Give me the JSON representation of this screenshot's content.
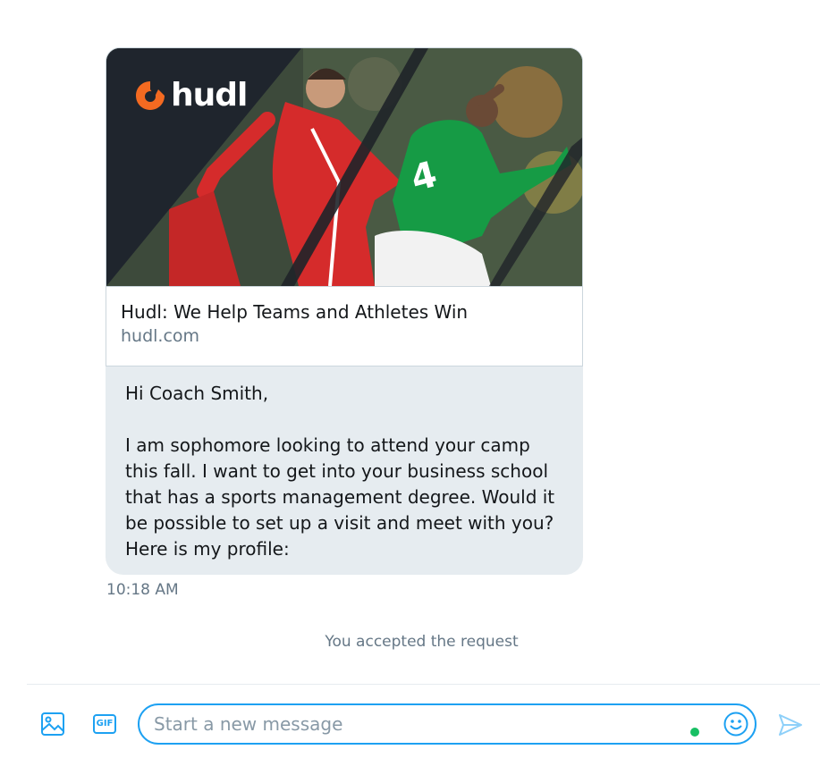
{
  "link_card": {
    "brand": "hudl",
    "title": "Hudl: We Help Teams and Athletes Win",
    "domain": "hudl.com"
  },
  "message": {
    "greeting": "Hi Coach Smith,",
    "body": "I am sophomore looking to attend your camp this fall. I want to get into your business school that has a sports management degree.   Would it be possible to set up a visit and meet with you? Here is my profile:",
    "timestamp": "10:18 AM"
  },
  "system_note": "You accepted the request",
  "composer": {
    "placeholder": "Start a new message",
    "value": "",
    "gif_label": "GIF"
  },
  "colors": {
    "accent": "#1da1f2",
    "bubble_bg": "#e6ecf0",
    "muted_text": "#657786",
    "online": "#17bf63",
    "brand_orange": "#f36a21"
  }
}
